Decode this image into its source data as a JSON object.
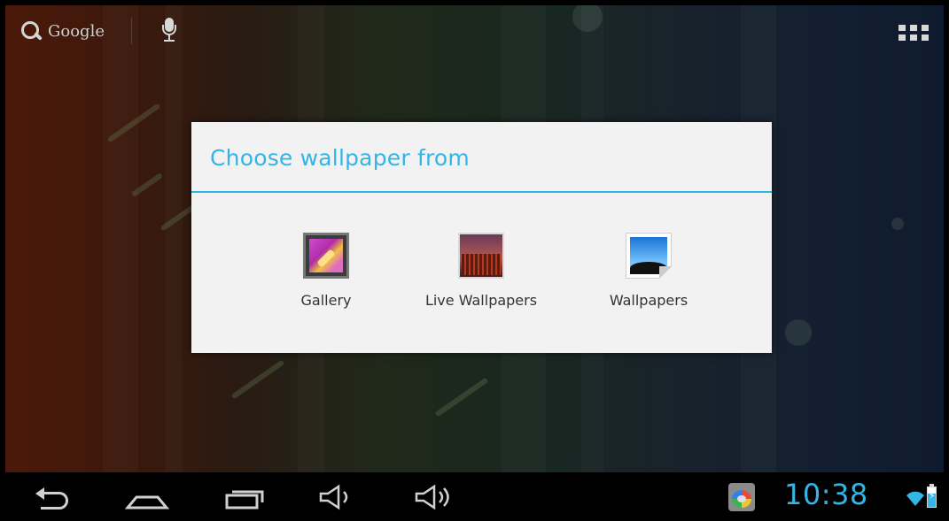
{
  "search_bar": {
    "label": "Google"
  },
  "dialog": {
    "title": "Choose wallpaper from",
    "options": [
      {
        "label": "Gallery",
        "icon": "gallery-icon"
      },
      {
        "label": "Live Wallpapers",
        "icon": "live-wallpapers-icon"
      },
      {
        "label": "Wallpapers",
        "icon": "wallpapers-icon"
      }
    ]
  },
  "status_bar": {
    "time": "10:38"
  },
  "colors": {
    "accent": "#33b5e5",
    "dialog_bg": "#f2f2f2",
    "navbar_bg": "#000000"
  }
}
